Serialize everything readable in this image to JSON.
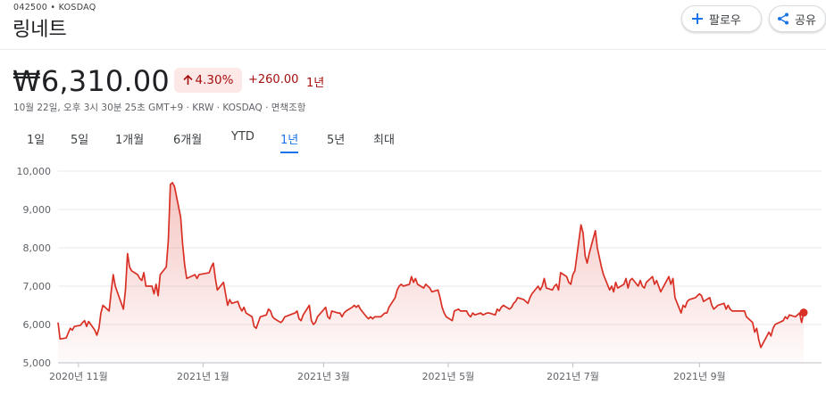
{
  "header": {
    "ticker": "042500 • KOSDAQ",
    "company": "링네트",
    "follow_label": "팔로우",
    "share_label": "공유"
  },
  "quote": {
    "price": "₩6,310.00",
    "change_pct": "4.30%",
    "change_abs": "+260.00",
    "change_period": "1년",
    "meta": "10월 22일, 오후 3시 30분 25초 GMT+9 · KRW · KOSDAQ · 면책조항"
  },
  "icons": {
    "follow": "plus-icon",
    "share": "share-icon",
    "change": "arrow-up-icon"
  },
  "colors": {
    "line": "#d93025",
    "positive_text": "#a50e0e",
    "positive_bg": "#fce8e6",
    "active_tab": "#1a73e8"
  },
  "tabs": [
    {
      "label": "1일",
      "active": false
    },
    {
      "label": "5일",
      "active": false
    },
    {
      "label": "1개월",
      "active": false
    },
    {
      "label": "6개월",
      "active": false
    },
    {
      "label": "YTD",
      "active": false
    },
    {
      "label": "1년",
      "active": true
    },
    {
      "label": "5년",
      "active": false
    },
    {
      "label": "최대",
      "active": false
    }
  ],
  "chart_data": {
    "type": "area",
    "ylim": [
      5000,
      10000
    ],
    "y_ticks": [
      5000,
      6000,
      7000,
      8000,
      9000,
      10000
    ],
    "y_tick_labels": [
      "5,000",
      "6,000",
      "7,000",
      "8,000",
      "9,000",
      "10,000"
    ],
    "x_ticks": [
      "2020-11-01",
      "2021-01-01",
      "2021-03-01",
      "2021-05-01",
      "2021-07-01",
      "2021-09-01"
    ],
    "x_tick_labels": [
      "2020년 11월",
      "2021년 1월",
      "2021년 3월",
      "2021년 5월",
      "2021년 7월",
      "2021년 9월"
    ],
    "grid": true,
    "series": [
      {
        "points": [
          [
            "2020-10-22",
            6050
          ],
          [
            "2020-10-23",
            5620
          ],
          [
            "2020-10-26",
            5650
          ],
          [
            "2020-10-27",
            5780
          ],
          [
            "2020-10-28",
            5900
          ],
          [
            "2020-10-29",
            5850
          ],
          [
            "2020-10-30",
            5950
          ],
          [
            "2020-11-02",
            5980
          ],
          [
            "2020-11-03",
            6050
          ],
          [
            "2020-11-04",
            6100
          ],
          [
            "2020-11-05",
            5950
          ],
          [
            "2020-11-06",
            6080
          ],
          [
            "2020-11-09",
            5850
          ],
          [
            "2020-11-10",
            5720
          ],
          [
            "2020-11-11",
            5900
          ],
          [
            "2020-11-12",
            6300
          ],
          [
            "2020-11-13",
            6500
          ],
          [
            "2020-11-16",
            6350
          ],
          [
            "2020-11-17",
            6850
          ],
          [
            "2020-11-18",
            7300
          ],
          [
            "2020-11-19",
            7000
          ],
          [
            "2020-11-20",
            6850
          ],
          [
            "2020-11-23",
            6400
          ],
          [
            "2020-11-24",
            6900
          ],
          [
            "2020-11-25",
            7850
          ],
          [
            "2020-11-26",
            7500
          ],
          [
            "2020-11-27",
            7400
          ],
          [
            "2020-11-30",
            7300
          ],
          [
            "2020-12-01",
            7200
          ],
          [
            "2020-12-02",
            7150
          ],
          [
            "2020-12-03",
            7350
          ],
          [
            "2020-12-04",
            7000
          ],
          [
            "2020-12-07",
            7000
          ],
          [
            "2020-12-08",
            6800
          ],
          [
            "2020-12-09",
            7050
          ],
          [
            "2020-12-10",
            6750
          ],
          [
            "2020-12-11",
            7300
          ],
          [
            "2020-12-14",
            7500
          ],
          [
            "2020-12-15",
            8200
          ],
          [
            "2020-12-16",
            9650
          ],
          [
            "2020-12-17",
            9700
          ],
          [
            "2020-12-18",
            9600
          ],
          [
            "2020-12-21",
            8800
          ],
          [
            "2020-12-22",
            8100
          ],
          [
            "2020-12-23",
            7550
          ],
          [
            "2020-12-24",
            7200
          ],
          [
            "2020-12-28",
            7300
          ],
          [
            "2020-12-29",
            7200
          ],
          [
            "2020-12-30",
            7300
          ],
          [
            "2021-01-04",
            7350
          ],
          [
            "2021-01-05",
            7500
          ],
          [
            "2021-01-06",
            7600
          ],
          [
            "2021-01-07",
            7200
          ],
          [
            "2021-01-08",
            6900
          ],
          [
            "2021-01-11",
            7100
          ],
          [
            "2021-01-12",
            6800
          ],
          [
            "2021-01-13",
            6500
          ],
          [
            "2021-01-14",
            6650
          ],
          [
            "2021-01-15",
            6550
          ],
          [
            "2021-01-18",
            6600
          ],
          [
            "2021-01-19",
            6450
          ],
          [
            "2021-01-20",
            6350
          ],
          [
            "2021-01-21",
            6450
          ],
          [
            "2021-01-22",
            6300
          ],
          [
            "2021-01-25",
            6200
          ],
          [
            "2021-01-26",
            5950
          ],
          [
            "2021-01-27",
            5900
          ],
          [
            "2021-01-28",
            6050
          ],
          [
            "2021-01-29",
            6200
          ],
          [
            "2021-02-01",
            6250
          ],
          [
            "2021-02-02",
            6400
          ],
          [
            "2021-02-03",
            6350
          ],
          [
            "2021-02-04",
            6200
          ],
          [
            "2021-02-05",
            6150
          ],
          [
            "2021-02-08",
            6050
          ],
          [
            "2021-02-09",
            6100
          ],
          [
            "2021-02-10",
            6200
          ],
          [
            "2021-02-15",
            6300
          ],
          [
            "2021-02-16",
            6350
          ],
          [
            "2021-02-17",
            6150
          ],
          [
            "2021-02-18",
            6100
          ],
          [
            "2021-02-19",
            6250
          ],
          [
            "2021-02-22",
            6500
          ],
          [
            "2021-02-23",
            6100
          ],
          [
            "2021-02-24",
            6000
          ],
          [
            "2021-02-25",
            6050
          ],
          [
            "2021-02-26",
            6200
          ],
          [
            "2021-03-02",
            6450
          ],
          [
            "2021-03-03",
            6200
          ],
          [
            "2021-03-04",
            6150
          ],
          [
            "2021-03-05",
            6350
          ],
          [
            "2021-03-08",
            6300
          ],
          [
            "2021-03-09",
            6300
          ],
          [
            "2021-03-10",
            6200
          ],
          [
            "2021-03-11",
            6300
          ],
          [
            "2021-03-12",
            6350
          ],
          [
            "2021-03-15",
            6450
          ],
          [
            "2021-03-16",
            6500
          ],
          [
            "2021-03-17",
            6450
          ],
          [
            "2021-03-18",
            6500
          ],
          [
            "2021-03-19",
            6400
          ],
          [
            "2021-03-22",
            6200
          ],
          [
            "2021-03-23",
            6150
          ],
          [
            "2021-03-24",
            6200
          ],
          [
            "2021-03-25",
            6150
          ],
          [
            "2021-03-26",
            6200
          ],
          [
            "2021-03-29",
            6200
          ],
          [
            "2021-03-30",
            6250
          ],
          [
            "2021-03-31",
            6300
          ],
          [
            "2021-04-01",
            6300
          ],
          [
            "2021-04-02",
            6450
          ],
          [
            "2021-04-05",
            6700
          ],
          [
            "2021-04-06",
            6900
          ],
          [
            "2021-04-07",
            7000
          ],
          [
            "2021-04-08",
            7050
          ],
          [
            "2021-04-09",
            7000
          ],
          [
            "2021-04-12",
            7050
          ],
          [
            "2021-04-13",
            7250
          ],
          [
            "2021-04-14",
            7100
          ],
          [
            "2021-04-15",
            7200
          ],
          [
            "2021-04-16",
            7050
          ],
          [
            "2021-04-19",
            6950
          ],
          [
            "2021-04-20",
            7050
          ],
          [
            "2021-04-21",
            7000
          ],
          [
            "2021-04-22",
            6950
          ],
          [
            "2021-04-23",
            6850
          ],
          [
            "2021-04-26",
            6900
          ],
          [
            "2021-04-27",
            6700
          ],
          [
            "2021-04-28",
            6450
          ],
          [
            "2021-04-29",
            6300
          ],
          [
            "2021-04-30",
            6200
          ],
          [
            "2021-05-03",
            6100
          ],
          [
            "2021-05-04",
            6350
          ],
          [
            "2021-05-06",
            6400
          ],
          [
            "2021-05-07",
            6350
          ],
          [
            "2021-05-10",
            6350
          ],
          [
            "2021-05-11",
            6250
          ],
          [
            "2021-05-12",
            6200
          ],
          [
            "2021-05-13",
            6300
          ],
          [
            "2021-05-14",
            6250
          ],
          [
            "2021-05-17",
            6300
          ],
          [
            "2021-05-18",
            6250
          ],
          [
            "2021-05-20",
            6300
          ],
          [
            "2021-05-21",
            6300
          ],
          [
            "2021-05-24",
            6250
          ],
          [
            "2021-05-25",
            6400
          ],
          [
            "2021-05-26",
            6350
          ],
          [
            "2021-05-27",
            6450
          ],
          [
            "2021-05-28",
            6500
          ],
          [
            "2021-05-31",
            6400
          ],
          [
            "2021-06-01",
            6450
          ],
          [
            "2021-06-02",
            6550
          ],
          [
            "2021-06-03",
            6600
          ],
          [
            "2021-06-04",
            6700
          ],
          [
            "2021-06-07",
            6650
          ],
          [
            "2021-06-08",
            6600
          ],
          [
            "2021-06-09",
            6550
          ],
          [
            "2021-06-10",
            6700
          ],
          [
            "2021-06-11",
            6800
          ],
          [
            "2021-06-14",
            7000
          ],
          [
            "2021-06-15",
            6900
          ],
          [
            "2021-06-16",
            7000
          ],
          [
            "2021-06-17",
            7200
          ],
          [
            "2021-06-18",
            6950
          ],
          [
            "2021-06-21",
            6900
          ],
          [
            "2021-06-22",
            7000
          ],
          [
            "2021-06-23",
            7050
          ],
          [
            "2021-06-24",
            6900
          ],
          [
            "2021-06-25",
            7350
          ],
          [
            "2021-06-28",
            7250
          ],
          [
            "2021-06-29",
            7100
          ],
          [
            "2021-06-30",
            7050
          ],
          [
            "2021-07-01",
            7300
          ],
          [
            "2021-07-02",
            7400
          ],
          [
            "2021-07-05",
            8600
          ],
          [
            "2021-07-06",
            8400
          ],
          [
            "2021-07-07",
            7800
          ],
          [
            "2021-07-08",
            7600
          ],
          [
            "2021-07-09",
            7850
          ],
          [
            "2021-07-12",
            8450
          ],
          [
            "2021-07-13",
            8000
          ],
          [
            "2021-07-14",
            7750
          ],
          [
            "2021-07-15",
            7500
          ],
          [
            "2021-07-16",
            7300
          ],
          [
            "2021-07-19",
            6900
          ],
          [
            "2021-07-20",
            7000
          ],
          [
            "2021-07-21",
            6850
          ],
          [
            "2021-07-22",
            7100
          ],
          [
            "2021-07-23",
            6950
          ],
          [
            "2021-07-26",
            7050
          ],
          [
            "2021-07-27",
            7200
          ],
          [
            "2021-07-28",
            6950
          ],
          [
            "2021-07-29",
            7150
          ],
          [
            "2021-07-30",
            7200
          ],
          [
            "2021-08-02",
            7000
          ],
          [
            "2021-08-03",
            7150
          ],
          [
            "2021-08-04",
            7000
          ],
          [
            "2021-08-05",
            6950
          ],
          [
            "2021-08-06",
            7100
          ],
          [
            "2021-08-09",
            7250
          ],
          [
            "2021-08-10",
            7050
          ],
          [
            "2021-08-11",
            7150
          ],
          [
            "2021-08-12",
            7000
          ],
          [
            "2021-08-13",
            6850
          ],
          [
            "2021-08-17",
            7250
          ],
          [
            "2021-08-18",
            7050
          ],
          [
            "2021-08-19",
            7200
          ],
          [
            "2021-08-20",
            6700
          ],
          [
            "2021-08-23",
            6300
          ],
          [
            "2021-08-24",
            6500
          ],
          [
            "2021-08-25",
            6450
          ],
          [
            "2021-08-26",
            6600
          ],
          [
            "2021-08-27",
            6650
          ],
          [
            "2021-08-30",
            6700
          ],
          [
            "2021-08-31",
            6750
          ],
          [
            "2021-09-01",
            6800
          ],
          [
            "2021-09-02",
            6750
          ],
          [
            "2021-09-03",
            6600
          ],
          [
            "2021-09-06",
            6700
          ],
          [
            "2021-09-07",
            6500
          ],
          [
            "2021-09-08",
            6400
          ],
          [
            "2021-09-09",
            6450
          ],
          [
            "2021-09-10",
            6500
          ],
          [
            "2021-09-13",
            6550
          ],
          [
            "2021-09-14",
            6400
          ],
          [
            "2021-09-15",
            6500
          ],
          [
            "2021-09-16",
            6400
          ],
          [
            "2021-09-17",
            6350
          ],
          [
            "2021-09-23",
            6350
          ],
          [
            "2021-09-24",
            6200
          ],
          [
            "2021-09-27",
            6050
          ],
          [
            "2021-09-28",
            5800
          ],
          [
            "2021-09-29",
            5900
          ],
          [
            "2021-09-30",
            5600
          ],
          [
            "2021-10-01",
            5400
          ],
          [
            "2021-10-05",
            5800
          ],
          [
            "2021-10-06",
            5700
          ],
          [
            "2021-10-07",
            5900
          ],
          [
            "2021-10-08",
            6000
          ],
          [
            "2021-10-12",
            6100
          ],
          [
            "2021-10-13",
            6200
          ],
          [
            "2021-10-14",
            6150
          ],
          [
            "2021-10-15",
            6250
          ],
          [
            "2021-10-18",
            6200
          ],
          [
            "2021-10-19",
            6250
          ],
          [
            "2021-10-20",
            6300
          ],
          [
            "2021-10-21",
            6050
          ],
          [
            "2021-10-22",
            6310
          ]
        ]
      }
    ]
  }
}
